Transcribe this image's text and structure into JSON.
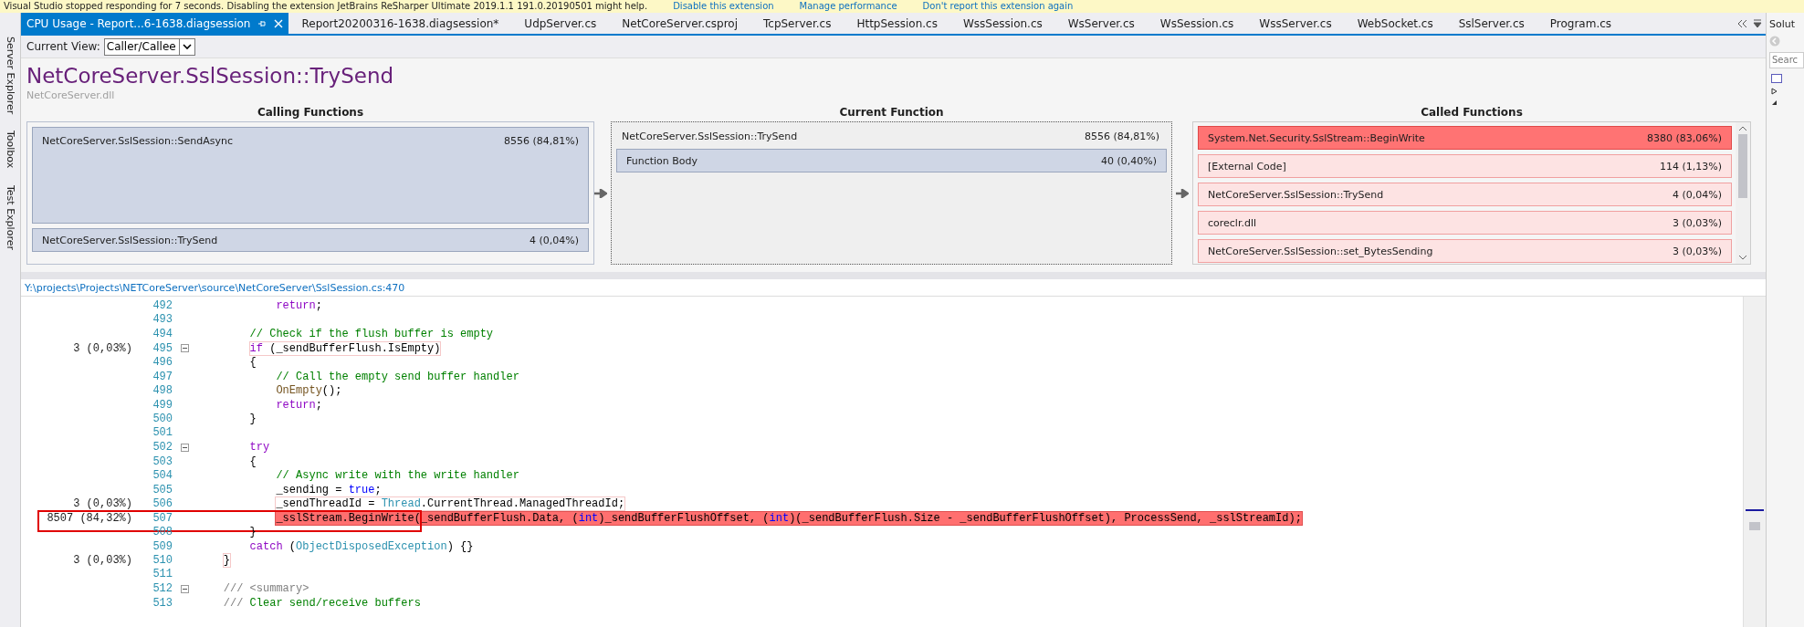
{
  "notification": {
    "message": "Visual Studio stopped responding for 7 seconds. Disabling the extension JetBrains ReSharper Ultimate 2019.1.1 191.0.20190501 might help.",
    "links": [
      "Disable this extension",
      "Manage performance",
      "Don't report this extension again"
    ]
  },
  "side_tabs": [
    "Server Explorer",
    "Toolbox",
    "Test Explorer"
  ],
  "tabs": [
    {
      "label": "CPU Usage - Report...6-1638.diagsession",
      "selected": true
    },
    {
      "label": "Report20200316-1638.diagsession*",
      "selected": false
    },
    {
      "label": "UdpServer.cs",
      "selected": false
    },
    {
      "label": "NetCoreServer.csproj",
      "selected": false
    },
    {
      "label": "TcpServer.cs",
      "selected": false
    },
    {
      "label": "HttpSession.cs",
      "selected": false
    },
    {
      "label": "WssSession.cs",
      "selected": false
    },
    {
      "label": "WsServer.cs",
      "selected": false
    },
    {
      "label": "WsSession.cs",
      "selected": false
    },
    {
      "label": "WssServer.cs",
      "selected": false
    },
    {
      "label": "WebSocket.cs",
      "selected": false
    },
    {
      "label": "SslServer.cs",
      "selected": false
    },
    {
      "label": "Program.cs",
      "selected": false
    }
  ],
  "view": {
    "label": "Current View:",
    "value": "Caller/Callee"
  },
  "function": {
    "name": "NetCoreServer.SslSession::TrySend",
    "module": "NetCoreServer.dll"
  },
  "calling": {
    "title": "Calling Functions",
    "rows": [
      {
        "name": "NetCoreServer.SslSession::SendAsync",
        "value": "8556 (84,81%)",
        "kind": "large"
      },
      {
        "name": "NetCoreServer.SslSession::TrySend",
        "value": "4 (0,04%)",
        "kind": "small"
      }
    ]
  },
  "current": {
    "title": "Current Function",
    "name": "NetCoreServer.SslSession::TrySend",
    "value": "8556 (84,81%)",
    "rows": [
      {
        "name": "Function Body",
        "value": "40 (0,40%)"
      }
    ]
  },
  "called": {
    "title": "Called Functions",
    "rows": [
      {
        "name": "System.Net.Security.SslStream::BeginWrite",
        "value": "8380 (83,06%)",
        "hot": true
      },
      {
        "name": "[External Code]",
        "value": "114 (1,13%)",
        "hot": false
      },
      {
        "name": "NetCoreServer.SslSession::TrySend",
        "value": "4 (0,04%)",
        "hot": false
      },
      {
        "name": "coreclr.dll",
        "value": "3 (0,03%)",
        "hot": false
      },
      {
        "name": "NetCoreServer.SslSession::set_BytesSending",
        "value": "3 (0,03%)",
        "hot": false
      }
    ]
  },
  "source_path": "Y:\\projects\\Projects\\NETCoreServer\\source\\NetCoreServer\\SslSession.cs:470",
  "code": {
    "lines": [
      {
        "number": "492",
        "foldable": false,
        "kind": "plain",
        "outlined": false,
        "tokens": [
          {
            "text": "            return",
            "kind": "control"
          },
          {
            "text": ";",
            "kind": "plain"
          }
        ]
      },
      {
        "number": "493",
        "foldable": false,
        "kind": "plain",
        "outlined": false
      },
      {
        "number": "494",
        "foldable": false,
        "kind": "plain",
        "outlined": false,
        "tokens": [
          {
            "text": "        // Check if the flush buffer is empty",
            "kind": "comment"
          }
        ]
      },
      {
        "number": "495",
        "hits": "3 (0,03%)",
        "foldable": true,
        "kind": "warm",
        "outlined": false,
        "tokens": [
          {
            "text": "        if",
            "kind": "control"
          },
          {
            "text": " (_sendBufferFlush.IsEmpty)",
            "kind": "plain"
          }
        ]
      },
      {
        "number": "496",
        "foldable": false,
        "kind": "plain",
        "outlined": false,
        "tokens": [
          {
            "text": "        {",
            "kind": "plain"
          }
        ]
      },
      {
        "number": "497",
        "foldable": false,
        "kind": "plain",
        "outlined": false,
        "tokens": [
          {
            "text": "            // Call the empty send buffer handler",
            "kind": "comment"
          }
        ]
      },
      {
        "number": "498",
        "foldable": false,
        "kind": "plain",
        "outlined": false,
        "tokens": [
          {
            "text": "            OnEmpty",
            "kind": "method"
          },
          {
            "text": "();",
            "kind": "plain"
          }
        ]
      },
      {
        "number": "499",
        "foldable": false,
        "kind": "plain",
        "outlined": false,
        "tokens": [
          {
            "text": "            return",
            "kind": "control"
          },
          {
            "text": ";",
            "kind": "plain"
          }
        ]
      },
      {
        "number": "500",
        "foldable": false,
        "kind": "plain",
        "outlined": false,
        "tokens": [
          {
            "text": "        }",
            "kind": "plain"
          }
        ]
      },
      {
        "number": "501",
        "foldable": false,
        "kind": "plain",
        "outlined": false
      },
      {
        "number": "502",
        "foldable": true,
        "kind": "plain",
        "outlined": false,
        "tokens": [
          {
            "text": "        try",
            "kind": "control"
          }
        ]
      },
      {
        "number": "503",
        "foldable": false,
        "kind": "plain",
        "outlined": false,
        "tokens": [
          {
            "text": "        {",
            "kind": "plain"
          }
        ]
      },
      {
        "number": "504",
        "foldable": false,
        "kind": "plain",
        "outlined": false,
        "tokens": [
          {
            "text": "            // Async write with the write handler",
            "kind": "comment"
          }
        ]
      },
      {
        "number": "505",
        "foldable": false,
        "kind": "plain",
        "outlined": false,
        "tokens": [
          {
            "text": "            _sending = ",
            "kind": "plain"
          },
          {
            "text": "true",
            "kind": "keyword"
          },
          {
            "text": ";",
            "kind": "plain"
          }
        ]
      },
      {
        "number": "506",
        "hits": "3 (0,03%)",
        "foldable": false,
        "kind": "warm",
        "outlined": false,
        "tokens": [
          {
            "text": "            _sendThreadId = ",
            "kind": "plain"
          },
          {
            "text": "Thread",
            "kind": "type"
          },
          {
            "text": ".CurrentThread.ManagedThreadId;",
            "kind": "plain"
          }
        ]
      },
      {
        "number": "507",
        "hits": "8507 (84,32%)",
        "foldable": false,
        "kind": "hot",
        "outlined": true,
        "tokens": [
          {
            "text": "            _sslStream.BeginWrite(_sendBufferFlush.Data, (",
            "kind": "plain"
          },
          {
            "text": "int",
            "kind": "keyword"
          },
          {
            "text": ")_sendBufferFlushOffset, (",
            "kind": "plain"
          },
          {
            "text": "int",
            "kind": "keyword"
          },
          {
            "text": ")(_sendBufferFlush.Size - _sendBufferFlushOffset), ProcessSend, _sslStreamId);",
            "kind": "plain"
          }
        ]
      },
      {
        "number": "508",
        "foldable": false,
        "kind": "plain",
        "outlined": false,
        "tokens": [
          {
            "text": "        }",
            "kind": "plain"
          }
        ]
      },
      {
        "number": "509",
        "foldable": false,
        "kind": "plain",
        "outlined": false,
        "tokens": [
          {
            "text": "        catch",
            "kind": "control"
          },
          {
            "text": " (",
            "kind": "plain"
          },
          {
            "text": "ObjectDisposedException",
            "kind": "type"
          },
          {
            "text": ") {}",
            "kind": "plain"
          }
        ]
      },
      {
        "number": "510",
        "hits": "3 (0,03%)",
        "foldable": false,
        "kind": "warm",
        "outlined": false,
        "tokens": [
          {
            "text": "    }",
            "kind": "plain"
          }
        ]
      },
      {
        "number": "511",
        "foldable": false,
        "kind": "plain",
        "outlined": false
      },
      {
        "number": "512",
        "foldable": true,
        "kind": "plain",
        "outlined": false,
        "tokens": [
          {
            "text": "    /// <summary>",
            "kind": "doc"
          }
        ]
      },
      {
        "number": "513",
        "foldable": false,
        "kind": "plain",
        "outlined": false,
        "tokens": [
          {
            "text": "    ///",
            "kind": "doc"
          },
          {
            "text": " Clear send/receive buffers",
            "kind": "comment"
          }
        ]
      }
    ]
  },
  "solution": {
    "title": "Solut",
    "search_placeholder": "Searc"
  }
}
